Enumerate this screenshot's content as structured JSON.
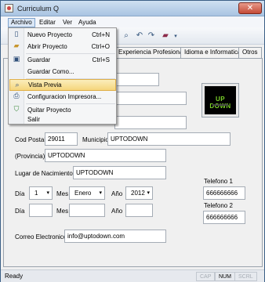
{
  "window": {
    "title": "Curriculum Q",
    "close_glyph": "✕"
  },
  "menubar": {
    "items": [
      "Archivo",
      "Editar",
      "Ver",
      "Ayuda"
    ]
  },
  "file_menu": {
    "items": [
      {
        "label": "Nuevo Proyecto",
        "shortcut": "Ctrl+N",
        "icon": "new-document-icon"
      },
      {
        "label": "Abrir Proyecto",
        "shortcut": "Ctrl+O",
        "icon": "open-folder-icon"
      },
      {
        "label": "Guardar",
        "shortcut": "Ctrl+S",
        "icon": "save-icon"
      },
      {
        "label": "Guardar Como...",
        "shortcut": "",
        "icon": ""
      },
      {
        "label": "Vista Previa",
        "shortcut": "",
        "icon": "print-preview-icon"
      },
      {
        "label": "Configuracion Impresora...",
        "shortcut": "",
        "icon": "printer-settings-icon"
      },
      {
        "label": "Quitar Proyecto",
        "shortcut": "",
        "icon": "remove-project-icon"
      },
      {
        "label": "Salir",
        "shortcut": "",
        "icon": ""
      }
    ]
  },
  "tabs": [
    "Experiencia Profesional",
    "Idioma e Informatica",
    "Otros"
  ],
  "form": {
    "name_value": "",
    "surname_value": "",
    "address_value": "",
    "cod_postal_label": "Cod Postal",
    "cod_postal_value": "29011",
    "municipio_label": "Municipio",
    "municipio_value": "UPTODOWN",
    "provincia_value": "(Provincia)",
    "provincia_field_value": "UPTODOWN",
    "nacimiento_label": "Lugar de Nacimiento",
    "nacimiento_value": "UPTODOWN",
    "dia_label": "Día",
    "mes_label": "Mes",
    "ano_label": "Año",
    "dia_value": "1",
    "mes_value": "Enero",
    "ano_value": "2012",
    "telefono1_label": "Telefono 1",
    "telefono1_value": "666666666",
    "telefono2_label": "Telefono 2",
    "telefono2_value": "666666666",
    "correo_label": "Correo Electronico",
    "correo_value": "info@uptodown.com",
    "photo_logo_text": "UP DOWN"
  },
  "statusbar": {
    "text": "Ready",
    "indicators": [
      "CAP",
      "NUM",
      "SCRL"
    ]
  }
}
